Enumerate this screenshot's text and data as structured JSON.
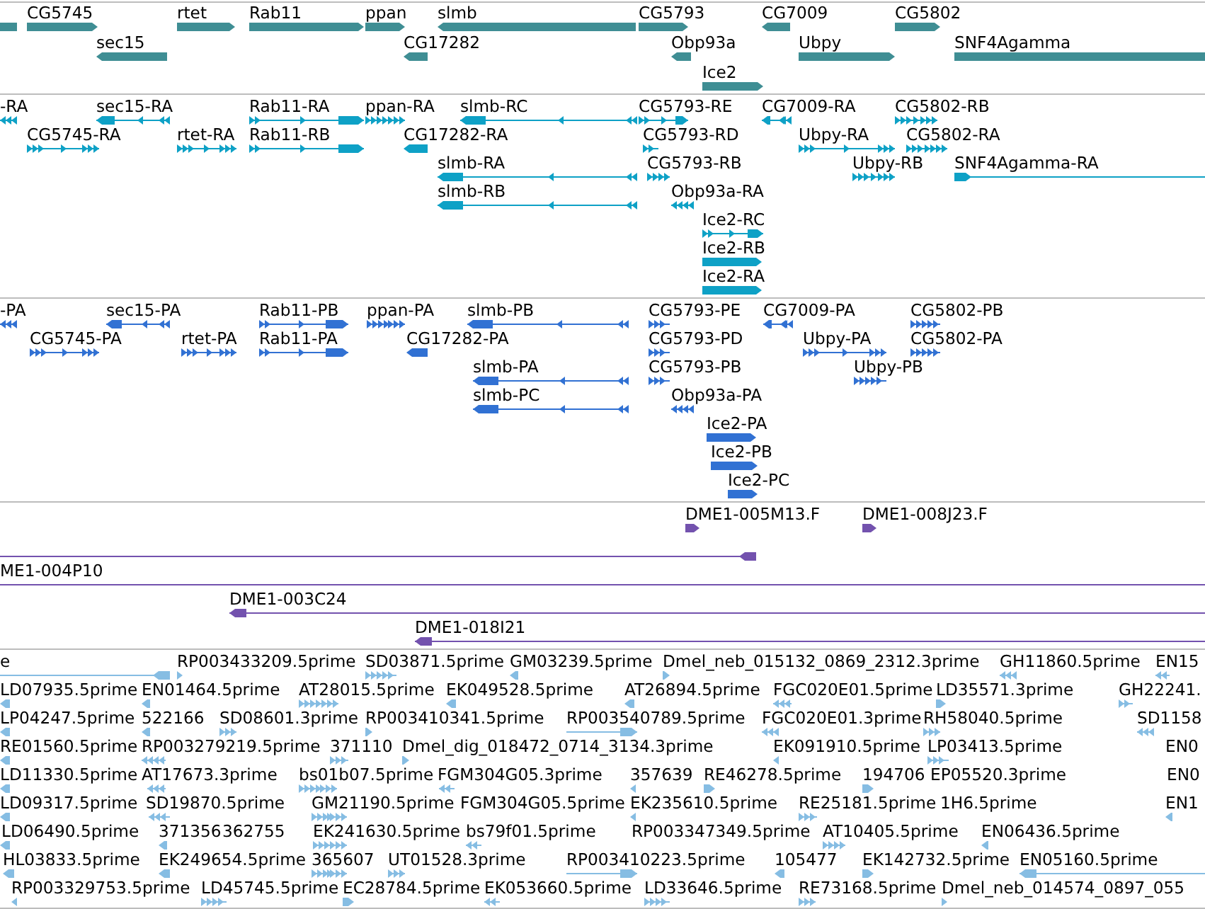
{
  "tracks": [
    {
      "kind": "gene",
      "features": [
        {
          "kind": "plain"
        },
        {
          "label": "CG5745",
          "kind": "forward"
        },
        {
          "label": "rtet",
          "kind": "forward"
        },
        {
          "label": "Rab11",
          "kind": "forward"
        },
        {
          "label": "ppan",
          "kind": "forward"
        },
        {
          "label": "slmb",
          "kind": "reverse"
        },
        {
          "label": "CG5793",
          "kind": "forward"
        },
        {
          "label": "CG7009",
          "kind": "reverse"
        },
        {
          "label": "CG5802",
          "kind": "forward"
        },
        {
          "label": "sec15",
          "kind": "reverse"
        },
        {
          "label": "CG17282",
          "kind": "reverse"
        },
        {
          "label": "Obp93a",
          "kind": "reverse"
        },
        {
          "label": "Ubpy",
          "kind": "forward"
        },
        {
          "label": "SNF4Agamma",
          "kind": "plain"
        },
        {
          "label": "Ice2",
          "kind": "forward"
        }
      ]
    },
    {
      "kind": "transcript",
      "features": [
        {
          "label": "-RA",
          "kind": "reverse"
        },
        {
          "label": "sec15-RA",
          "kind": "reverse"
        },
        {
          "label": "Rab11-RA",
          "kind": "forward"
        },
        {
          "label": "ppan-RA",
          "kind": "forward"
        },
        {
          "label": "slmb-RC",
          "kind": "reverse"
        },
        {
          "label": "CG5793-RE",
          "kind": "forward"
        },
        {
          "label": "CG7009-RA",
          "kind": "reverse"
        },
        {
          "label": "CG5802-RB",
          "kind": "forward"
        },
        {
          "label": "CG5745-RA",
          "kind": "forward"
        },
        {
          "label": "rtet-RA",
          "kind": "forward"
        },
        {
          "label": "Rab11-RB",
          "kind": "forward"
        },
        {
          "label": "CG17282-RA",
          "kind": "reverse"
        },
        {
          "label": "CG5793-RD",
          "kind": "forward"
        },
        {
          "label": "Ubpy-RA",
          "kind": "forward"
        },
        {
          "label": "CG5802-RA",
          "kind": "forward"
        },
        {
          "label": "slmb-RA",
          "kind": "reverse"
        },
        {
          "label": "CG5793-RB",
          "kind": "forward"
        },
        {
          "label": "Ubpy-RB",
          "kind": "forward"
        },
        {
          "label": "SNF4Agamma-RA",
          "kind": "forward"
        },
        {
          "label": "slmb-RB",
          "kind": "reverse"
        },
        {
          "label": "Obp93a-RA",
          "kind": "reverse"
        },
        {
          "label": "Ice2-RC",
          "kind": "forward"
        },
        {
          "label": "Ice2-RB",
          "kind": "forward"
        },
        {
          "label": "Ice2-RA",
          "kind": "forward"
        }
      ]
    },
    {
      "kind": "protein",
      "features": [
        {
          "label": "-PA",
          "kind": "reverse"
        },
        {
          "label": "sec15-PA",
          "kind": "reverse"
        },
        {
          "label": "Rab11-PB",
          "kind": "forward"
        },
        {
          "label": "ppan-PA",
          "kind": "forward"
        },
        {
          "label": "slmb-PB",
          "kind": "reverse"
        },
        {
          "label": "CG5793-PE",
          "kind": "forward"
        },
        {
          "label": "CG7009-PA",
          "kind": "reverse"
        },
        {
          "label": "CG5802-PB",
          "kind": "forward"
        },
        {
          "label": "CG5745-PA",
          "kind": "forward"
        },
        {
          "label": "rtet-PA",
          "kind": "forward"
        },
        {
          "label": "Rab11-PA",
          "kind": "forward"
        },
        {
          "label": "CG17282-PA",
          "kind": "reverse"
        },
        {
          "label": "CG5793-PD",
          "kind": "forward"
        },
        {
          "label": "Ubpy-PA",
          "kind": "forward"
        },
        {
          "label": "CG5802-PA",
          "kind": "forward"
        },
        {
          "label": "slmb-PA",
          "kind": "reverse"
        },
        {
          "label": "CG5793-PB",
          "kind": "forward"
        },
        {
          "label": "Ubpy-PB",
          "kind": "forward"
        },
        {
          "label": "slmb-PC",
          "kind": "reverse"
        },
        {
          "label": "Obp93a-PA",
          "kind": "reverse"
        },
        {
          "label": "Ice2-PA",
          "kind": "forward"
        },
        {
          "label": "Ice2-PB",
          "kind": "forward"
        },
        {
          "label": "Ice2-PC",
          "kind": "forward"
        }
      ]
    },
    {
      "kind": "clone",
      "features": [
        {
          "label": "DME1-005M13.F",
          "kind": "forward"
        },
        {
          "label": "DME1-008J23.F",
          "kind": "forward"
        },
        {
          "kind": "reverse"
        },
        {
          "label": "ME1-004P10",
          "kind": "plain"
        },
        {
          "label": "DME1-003C24",
          "kind": "reverse"
        },
        {
          "label": "DME1-018I21",
          "kind": "reverse"
        }
      ]
    },
    {
      "kind": "est",
      "features": [
        {
          "label": "e",
          "kind": "reverse"
        },
        {
          "label": "RP003433209.5prime",
          "kind": "forward"
        },
        {
          "label": "SD03871.5prime",
          "kind": "forward"
        },
        {
          "label": "GM03239.5prime",
          "kind": "reverse"
        },
        {
          "label": "Dmel_neb_015132_0869_2312.3prime",
          "kind": "forward"
        },
        {
          "label": "GH11860.5prime",
          "kind": "reverse"
        },
        {
          "label": "EN15",
          "kind": "reverse"
        },
        {
          "label": "LD07935.5prime",
          "kind": "reverse"
        },
        {
          "label": "EN01464.5prime",
          "kind": "reverse"
        },
        {
          "label": "AT28015.5prime",
          "kind": "forward"
        },
        {
          "label": "EK049528.5prime",
          "kind": "reverse"
        },
        {
          "label": "AT26894.5prime",
          "kind": "reverse"
        },
        {
          "label": "FGC020E01.5prime",
          "kind": "reverse"
        },
        {
          "label": "LD35571.3prime",
          "kind": "forward"
        },
        {
          "label": "GH22241.",
          "kind": "forward"
        },
        {
          "label": "LP04247.5prime",
          "kind": "reverse"
        },
        {
          "label": "522166",
          "kind": "reverse"
        },
        {
          "label": "SD08601.3prime",
          "kind": "forward"
        },
        {
          "label": "RP003410341.5prime",
          "kind": "forward"
        },
        {
          "label": "RP003540789.5prime",
          "kind": "forward"
        },
        {
          "label": "FGC020E01.3prime",
          "kind": "reverse"
        },
        {
          "label": "RH58040.5prime",
          "kind": "forward"
        },
        {
          "label": "SD1158",
          "kind": "reverse"
        },
        {
          "label": "RE01560.5prime",
          "kind": "reverse"
        },
        {
          "label": "RP003279219.5prime",
          "kind": "reverse"
        },
        {
          "label": "371110",
          "kind": "forward"
        },
        {
          "label": "Dmel_dig_018472_0714_3134.3prime",
          "kind": "forward"
        },
        {
          "label": "EK091910.5prime",
          "kind": "reverse"
        },
        {
          "label": "LP03413.5prime",
          "kind": "forward"
        },
        {
          "label": "EN0",
          "kind": "text"
        },
        {
          "label": "LD11330.5prime",
          "kind": "reverse"
        },
        {
          "label": "AT17673.3prime",
          "kind": "reverse"
        },
        {
          "label": "bs01b07.5prime",
          "kind": "forward"
        },
        {
          "label": "FGM304G05.3prime",
          "kind": "reverse"
        },
        {
          "label": "357639",
          "kind": "reverse"
        },
        {
          "label": "RE46278.5prime",
          "kind": "forward"
        },
        {
          "label": "194706",
          "kind": "forward"
        },
        {
          "label": "EP05520.3prime",
          "kind": "text"
        },
        {
          "label": "EN0",
          "kind": "text"
        },
        {
          "label": "LD09317.5prime",
          "kind": "reverse"
        },
        {
          "label": "SD19870.5prime",
          "kind": "reverse"
        },
        {
          "label": "GM21190.5prime",
          "kind": "forward"
        },
        {
          "label": "FGM304G05.5prime",
          "kind": "text"
        },
        {
          "label": "EK235610.5prime",
          "kind": "reverse"
        },
        {
          "label": "RE25181.5prime",
          "kind": "forward"
        },
        {
          "label": "1H6.5prime",
          "kind": "text"
        },
        {
          "label": "EN1",
          "kind": "reverse"
        },
        {
          "label": "LD06490.5prime",
          "kind": "reverse"
        },
        {
          "label": "371356",
          "kind": "reverse"
        },
        {
          "label": "362755",
          "kind": "text"
        },
        {
          "label": "EK241630.5prime",
          "kind": "forward"
        },
        {
          "label": "bs79f01.5prime",
          "kind": "reverse"
        },
        {
          "label": "RP003347349.5prime",
          "kind": "text"
        },
        {
          "label": "AT10405.5prime",
          "kind": "forward"
        },
        {
          "label": "EN06436.5prime",
          "kind": "reverse"
        },
        {
          "label": "HL03833.5prime",
          "kind": "reverse"
        },
        {
          "label": "EK249654.5prime",
          "kind": "reverse"
        },
        {
          "label": "365607",
          "kind": "forward"
        },
        {
          "label": "UT01528.3prime",
          "kind": "forward"
        },
        {
          "label": "RP003410223.5prime",
          "kind": "forward"
        },
        {
          "label": "105477",
          "kind": "reverse"
        },
        {
          "label": "EK142732.5prime",
          "kind": "forward"
        },
        {
          "label": "EN05160.5prime",
          "kind": "reverse"
        },
        {
          "label": "RP003329753.5prime",
          "kind": "reverse"
        },
        {
          "label": "LD45745.5prime",
          "kind": "forward"
        },
        {
          "label": "EC28784.5prime",
          "kind": "forward"
        },
        {
          "label": "EK053660.5prime",
          "kind": "reverse"
        },
        {
          "label": "LD33646.5prime",
          "kind": "forward"
        },
        {
          "label": "RE73168.5prime",
          "kind": "forward"
        },
        {
          "label": "Dmel_neb_014574_0897_055",
          "kind": "forward"
        }
      ]
    }
  ]
}
